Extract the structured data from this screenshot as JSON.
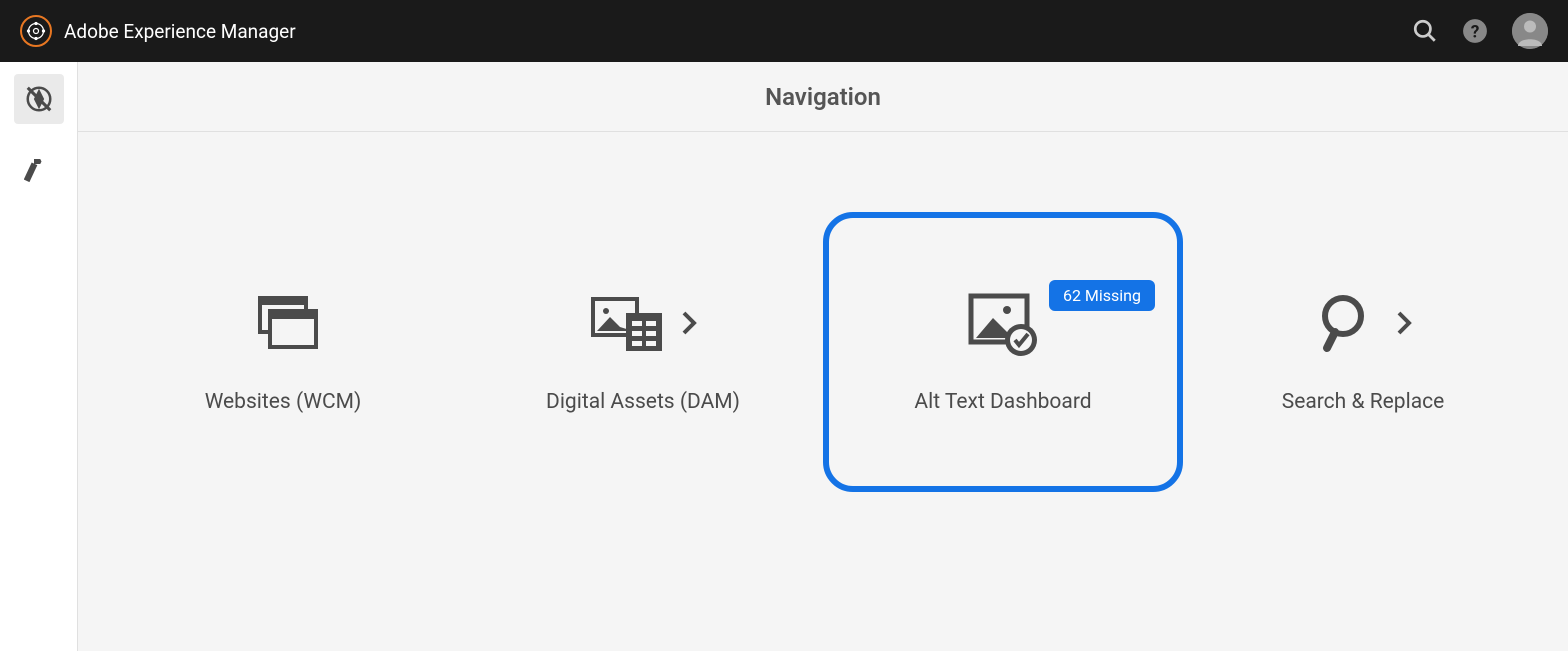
{
  "header": {
    "app_title": "Adobe Experience Manager"
  },
  "page": {
    "title": "Navigation"
  },
  "tiles": {
    "websites": {
      "label": "Websites (WCM)"
    },
    "digital_assets": {
      "label": "Digital Assets (DAM)"
    },
    "alt_text": {
      "label": "Alt Text Dashboard",
      "badge": "62 Missing"
    },
    "search_replace": {
      "label": "Search & Replace"
    }
  }
}
